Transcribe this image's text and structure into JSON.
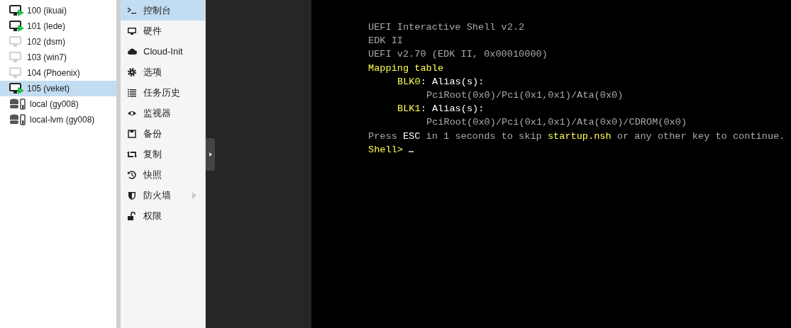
{
  "tree": {
    "items": [
      {
        "kind": "vm",
        "label": "100 (ikuai)",
        "running": true,
        "selected": false
      },
      {
        "kind": "vm",
        "label": "101 (lede)",
        "running": true,
        "selected": false
      },
      {
        "kind": "vm",
        "label": "102 (dsm)",
        "running": false,
        "selected": false
      },
      {
        "kind": "vm",
        "label": "103 (win7)",
        "running": false,
        "selected": false
      },
      {
        "kind": "vm",
        "label": "104 (Phoenix)",
        "running": false,
        "selected": false
      },
      {
        "kind": "vm",
        "label": "105 (veket)",
        "running": true,
        "selected": true
      },
      {
        "kind": "storage",
        "label": "local (gy008)",
        "selected": false
      },
      {
        "kind": "storage",
        "label": "local-lvm (gy008)",
        "selected": false
      }
    ]
  },
  "menu": {
    "items": [
      {
        "kind": "terminal",
        "label": "控制台",
        "selected": true,
        "submenu": false
      },
      {
        "kind": "monitor",
        "label": "硬件",
        "selected": false,
        "submenu": false
      },
      {
        "kind": "cloud",
        "label": "Cloud-Init",
        "selected": false,
        "submenu": false
      },
      {
        "kind": "gear",
        "label": "选项",
        "selected": false,
        "submenu": false
      },
      {
        "kind": "list",
        "label": "任务历史",
        "selected": false,
        "submenu": false
      },
      {
        "kind": "eye",
        "label": "监视器",
        "selected": false,
        "submenu": false
      },
      {
        "kind": "save",
        "label": "备份",
        "selected": false,
        "submenu": false
      },
      {
        "kind": "retweet",
        "label": "复制",
        "selected": false,
        "submenu": false
      },
      {
        "kind": "history",
        "label": "快照",
        "selected": false,
        "submenu": false
      },
      {
        "kind": "shield",
        "label": "防火墙",
        "selected": false,
        "submenu": true
      },
      {
        "kind": "unlock",
        "label": "权限",
        "selected": false,
        "submenu": false
      }
    ]
  },
  "console": {
    "lines": [
      {
        "kind": "plain",
        "segments": [
          {
            "kind": "dim",
            "text": "UEFI Interactive Shell v2.2"
          }
        ]
      },
      {
        "kind": "plain",
        "segments": [
          {
            "kind": "dim",
            "text": "EDK II"
          }
        ]
      },
      {
        "kind": "plain",
        "segments": [
          {
            "kind": "dim",
            "text": "UEFI v2.70 (EDK II, 0x00010000)"
          }
        ]
      },
      {
        "kind": "plain",
        "segments": [
          {
            "kind": "yellow",
            "text": "Mapping table"
          }
        ]
      },
      {
        "kind": "mapping",
        "segments": [
          {
            "kind": "yellow",
            "text": "BLK0"
          },
          {
            "kind": "white",
            "text": ": Alias(s):"
          }
        ]
      },
      {
        "kind": "path",
        "segments": [
          {
            "kind": "dim",
            "text": "PciRoot(0x0)/Pci(0x1,0x1)/Ata(0x0)"
          }
        ]
      },
      {
        "kind": "mapping",
        "segments": [
          {
            "kind": "yellow",
            "text": "BLK1"
          },
          {
            "kind": "white",
            "text": ": Alias(s):"
          }
        ]
      },
      {
        "kind": "path",
        "segments": [
          {
            "kind": "dim",
            "text": "PciRoot(0x0)/Pci(0x1,0x1)/Ata(0x0)/CDROM(0x0)"
          }
        ]
      },
      {
        "kind": "plain",
        "segments": [
          {
            "kind": "dim",
            "text": "Press "
          },
          {
            "kind": "white",
            "text": "ESC"
          },
          {
            "kind": "dim",
            "text": " in 1 seconds to skip "
          },
          {
            "kind": "yellow",
            "text": "startup.nsh"
          },
          {
            "kind": "dim",
            "text": " or any other key to continue."
          }
        ]
      },
      {
        "kind": "prompt",
        "segments": [
          {
            "kind": "yellow",
            "text": "Shell> "
          }
        ]
      }
    ]
  }
}
